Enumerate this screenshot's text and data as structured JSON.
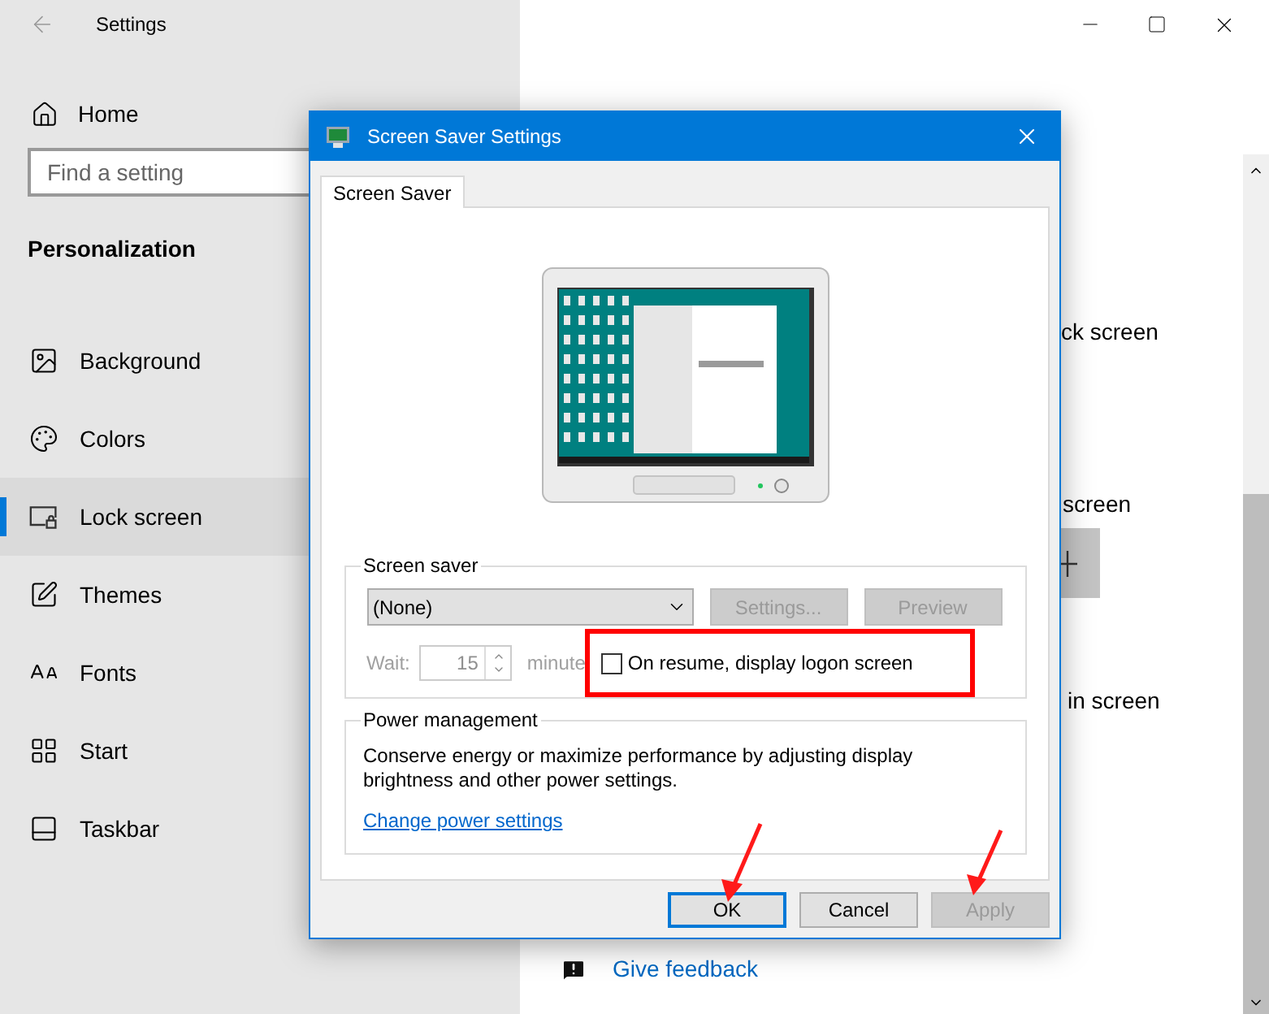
{
  "settings_window": {
    "title": "Settings",
    "home": "Home",
    "search": {
      "placeholder": "Find a setting"
    },
    "section": "Personalization",
    "nav_items": [
      {
        "label": "Background",
        "selected": false
      },
      {
        "label": "Colors",
        "selected": false
      },
      {
        "label": "Lock screen",
        "selected": true
      },
      {
        "label": "Themes",
        "selected": false
      },
      {
        "label": "Fonts",
        "selected": false
      },
      {
        "label": "Start",
        "selected": false
      },
      {
        "label": "Taskbar",
        "selected": false
      }
    ],
    "fragments": [
      "ck screen",
      "screen",
      "in screen"
    ],
    "feedback_link": "Give feedback"
  },
  "dialog": {
    "title": "Screen Saver Settings",
    "tabs": [
      {
        "label": "Screen Saver",
        "selected": true
      }
    ],
    "screen_saver": {
      "group_label": "Screen saver",
      "selected_value": "(None)",
      "side_buttons": [
        {
          "label": "Settings...",
          "disabled": true
        },
        {
          "label": "Preview",
          "disabled": true
        }
      ],
      "wait": {
        "label": "Wait:",
        "value": "15",
        "unit": "minute",
        "disabled": true
      },
      "logon_checkbox": {
        "label": "On resume, display logon screen",
        "checked": false
      }
    },
    "power": {
      "group_label": "Power management",
      "description": "Conserve energy or maximize performance by adjusting display brightness and other power settings.",
      "link": "Change power settings"
    },
    "buttons": [
      {
        "label": "OK",
        "default": true,
        "disabled": false
      },
      {
        "label": "Cancel",
        "default": false,
        "disabled": false
      },
      {
        "label": "Apply",
        "default": false,
        "disabled": true
      }
    ]
  }
}
